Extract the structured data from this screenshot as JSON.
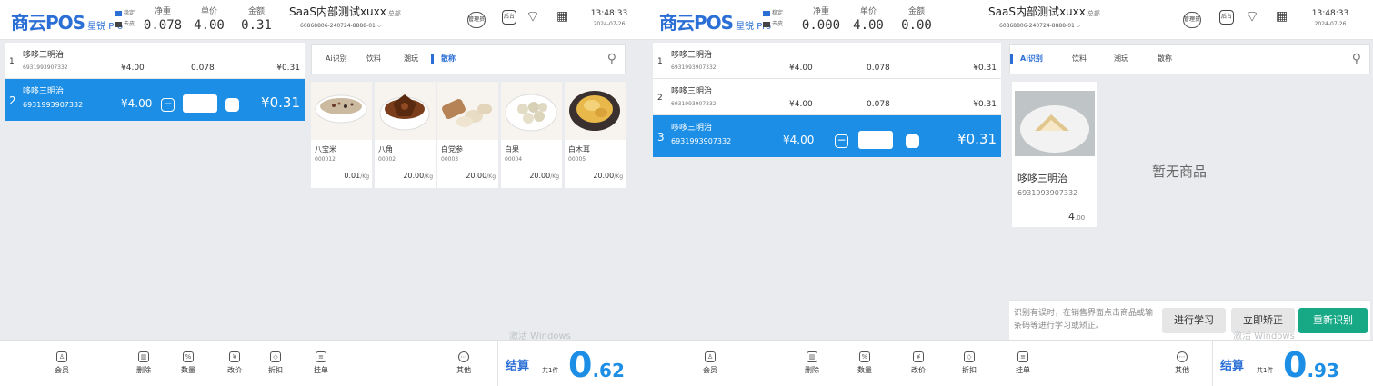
{
  "colors": {
    "accent": "#1c8ee6",
    "brand": "#2b6fd6",
    "teal": "#17a886"
  },
  "screens": [
    {
      "header": {
        "logo": "商云POS",
        "logo_sub": "星锐 Pro",
        "legend_a": "稳定",
        "legend_b": "去皮",
        "net_weight_label": "净重",
        "net_weight": "0.078",
        "unit_price_label": "单价",
        "unit_price": "4.00",
        "amount_label": "金额",
        "amount": "0.31",
        "store_name": "SaaS内部测试xuxx",
        "store_tag": "总部",
        "store_id": "60868806-240724-8888-01",
        "icon_manage": "管理员",
        "icon_backend": "后台",
        "time": "13:48:33",
        "date": "2024-07-26"
      },
      "cart": [
        {
          "no": "1",
          "name": "哆哆三明治",
          "barcode": "6931993907332",
          "price": "¥4.00",
          "qty": "0.078",
          "total": "¥0.31"
        },
        {
          "no": "2",
          "name": "哆哆三明治",
          "barcode": "6931993907332",
          "price": "¥4.00",
          "qty": "0.078",
          "total": "¥0.31"
        }
      ],
      "tabs": [
        "Ai识别",
        "饮料",
        "潮玩",
        "散称"
      ],
      "products": [
        {
          "name": "八宝米",
          "code": "000012",
          "price": "0.01",
          "unit": "/Kg"
        },
        {
          "name": "八角",
          "code": "00002",
          "price": "20.00",
          "unit": "/Kg"
        },
        {
          "name": "白党参",
          "code": "00003",
          "price": "20.00",
          "unit": "/Kg"
        },
        {
          "name": "白果",
          "code": "00004",
          "price": "20.00",
          "unit": "/Kg"
        },
        {
          "name": "白木耳",
          "code": "00005",
          "price": "20.00",
          "unit": "/Kg"
        }
      ],
      "watermark": "激活 Windows",
      "settle": {
        "label": "结算",
        "count": "共1件",
        "amount_int": "0",
        "amount_dec": ".62"
      }
    },
    {
      "header": {
        "logo": "商云POS",
        "logo_sub": "星锐 Pro",
        "legend_a": "稳定",
        "legend_b": "去皮",
        "net_weight_label": "净重",
        "net_weight": "0.000",
        "unit_price_label": "单价",
        "unit_price": "4.00",
        "amount_label": "金额",
        "amount": "0.00",
        "store_name": "SaaS内部测试xuxx",
        "store_tag": "总部",
        "store_id": "60868806-240724-8888-01",
        "icon_manage": "管理员",
        "icon_backend": "后台",
        "time": "13:48:33",
        "date": "2024-07-26"
      },
      "cart": [
        {
          "no": "1",
          "name": "哆哆三明治",
          "barcode": "6931993907332",
          "price": "¥4.00",
          "qty": "0.078",
          "total": "¥0.31"
        },
        {
          "no": "2",
          "name": "哆哆三明治",
          "barcode": "6931993907332",
          "price": "¥4.00",
          "qty": "0.078",
          "total": "¥0.31"
        },
        {
          "no": "3",
          "name": "哆哆三明治",
          "barcode": "6931993907332",
          "price": "¥4.00",
          "qty": "0.078",
          "total": "¥0.31"
        }
      ],
      "tabs": [
        "Ai识别",
        "饮料",
        "潮玩",
        "散称"
      ],
      "ai_product": {
        "name": "哆哆三明治",
        "barcode": "6931993907332",
        "price": "4",
        "price_dec": ".00"
      },
      "empty_text": "暂无商品",
      "help_text": "识别有误时，在销售界面点击商品或输条码等进行学习或矫正。",
      "btn_learn": "进行学习",
      "btn_correct": "立即矫正",
      "btn_rescan": "重新识别",
      "watermark": "激活 Windows",
      "settle": {
        "label": "结算",
        "count": "共1件",
        "amount_int": "0",
        "amount_dec": ".93"
      }
    }
  ],
  "toolbar": {
    "member": "会员",
    "delete": "删除",
    "quantity": "数量",
    "change_price": "改价",
    "discount": "折扣",
    "hold": "挂单",
    "other": "其他"
  }
}
